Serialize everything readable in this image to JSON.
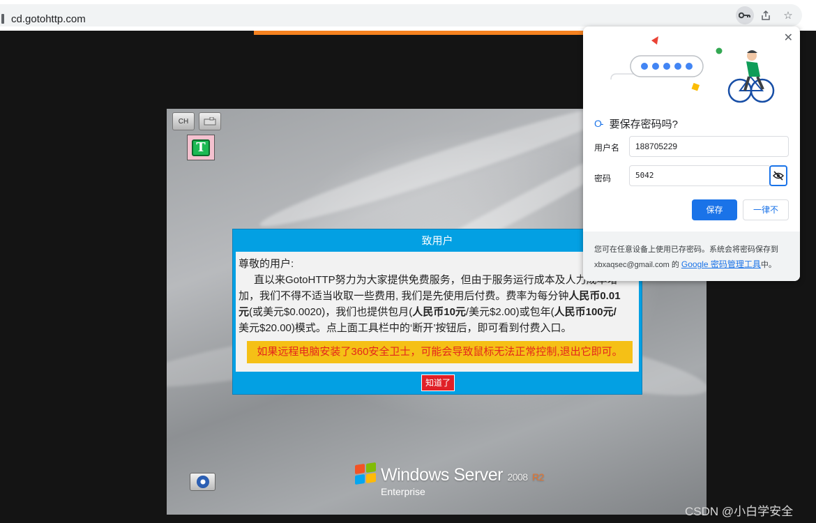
{
  "browser": {
    "url": "cd.gotohttp.com"
  },
  "remote_toolbar": {
    "ch_label": "CH"
  },
  "dialog": {
    "title": "致用户",
    "greeting": "尊敬的用户:",
    "p1": "直以来GotoHTTP努力为大家提供免费服务，但由于服务运行成本及人力成本增",
    "p2": "加，我们不得不适当收取一些费用, 我们是先使用后付费。费率为每分钟",
    "rate_min": "人民币0.01",
    "p3a": "元",
    "p3b": "(或美元$0.0020)，我们也提供包月(",
    "rate_month": "人民币10元",
    "p3c": "/美元$2.00)或包年(",
    "rate_year": "人民币100元",
    "p3d": "/",
    "p4": "美元$20.00)模式。点上面工具栏中的‘断开’按钮后，即可看到付费入口。",
    "warning": "如果远程电脑安装了360安全卫士，可能会导致鼠标无法正常控制,退出它即可。",
    "ok_label": "知道了"
  },
  "desktop": {
    "os_name": "Windows Server",
    "os_version": "2008",
    "os_release": "R2",
    "os_edition": "Enterprise"
  },
  "password_prompt": {
    "title": "要保存密码吗?",
    "username_label": "用户名",
    "username_value": "188705229",
    "password_label": "密码",
    "password_value": "5042",
    "save_label": "保存",
    "never_label": "一律不",
    "footer_text": "您可在任意设备上使用已存密码。系统会将密码保存到",
    "footer_account": "xbxaqsec@gmail.com 的",
    "footer_link": "Google 密码管理工具",
    "footer_tail": "中。"
  },
  "watermark": "CSDN @小白学安全",
  "colors": {
    "dialog_blue": "#03a0e3",
    "warning_bg": "#f5c016",
    "warning_text": "#e4261c",
    "ok_button": "#e02027",
    "chrome_blue": "#1a73e8",
    "orange_strip": "#f58220"
  },
  "icons": [
    "lock-icon",
    "key-icon",
    "share-icon",
    "star-icon",
    "close-icon",
    "eye-off-icon",
    "gear-icon",
    "windows-logo-icon"
  ]
}
